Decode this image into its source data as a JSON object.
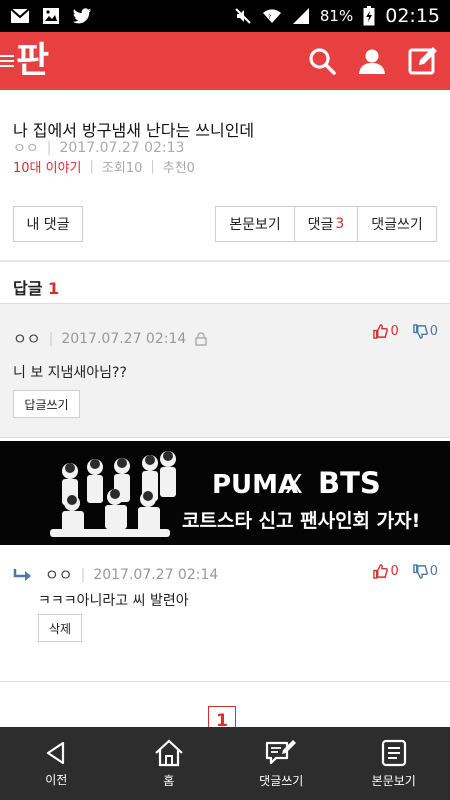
{
  "statusbar": {
    "left_icons": [
      "mail-icon",
      "image-icon",
      "twitter-icon"
    ],
    "battery": "81%",
    "time": "02:15"
  },
  "appbar": {
    "logo_text": "판",
    "actions": [
      "search-icon",
      "profile-icon",
      "write-icon"
    ]
  },
  "post": {
    "title": "나 집에서 방구냄새 난다는 쓰니인데",
    "author": "ㅇㅇ",
    "date": "2017.07.27 02:13",
    "category": "10대 이야기",
    "views": "조회10",
    "recommends": "추천0"
  },
  "buttons": {
    "my_comments": "내 댓글",
    "view_post": "본문보기",
    "comments_label": "댓글",
    "comments_count": "3",
    "write_comment": "댓글쓰기"
  },
  "replies_header": {
    "label": "답글",
    "count": "1"
  },
  "comment1": {
    "nick": "ㅇㅇ",
    "date": "2017.07.27 02:14",
    "up": "0",
    "down": "0",
    "text": "니 보 지냄새아님??",
    "reply_button": "답글쓰기"
  },
  "ad": {
    "brand": "PUMA",
    "x": "X",
    "partner": "BTS",
    "tagline": "코트스타 신고 팬사인회 가자!"
  },
  "reply": {
    "nick": "ㅇㅇ",
    "date": "2017.07.27 02:14",
    "up": "0",
    "down": "0",
    "text": "ㅋㅋㅋ아니라고 씨 발련아",
    "delete_button": "삭제"
  },
  "pagination": {
    "current": "1"
  },
  "bottom_nav": [
    {
      "label": "이전",
      "icon": "back-icon"
    },
    {
      "label": "홈",
      "icon": "home-icon"
    },
    {
      "label": "댓글쓰기",
      "icon": "comment-write-icon"
    },
    {
      "label": "본문보기",
      "icon": "document-icon"
    }
  ],
  "colors": {
    "brand_red": "#e84040",
    "accent_red": "#d52f2f",
    "navbar": "#2d2d2d"
  }
}
